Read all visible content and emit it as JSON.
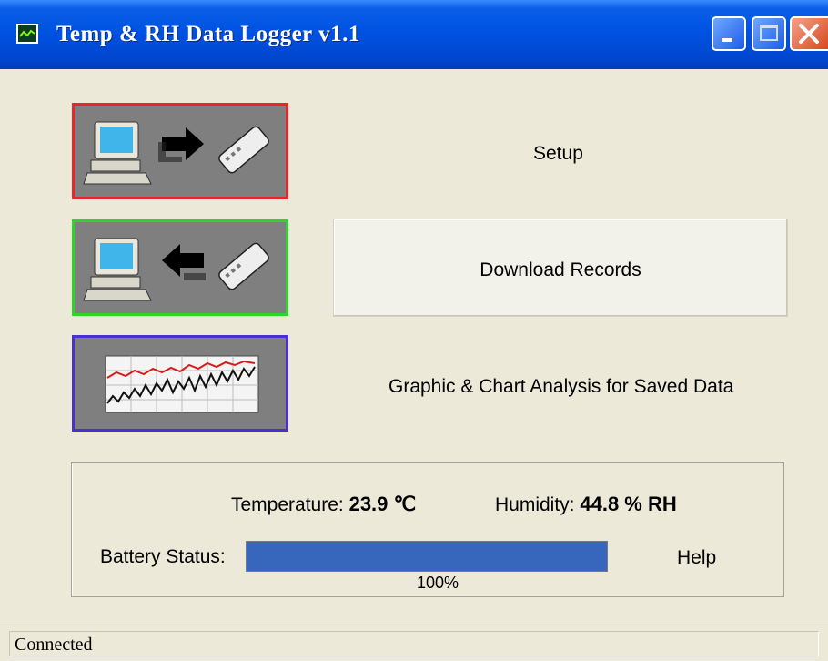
{
  "window": {
    "title": "Temp & RH Data Logger  v1.1"
  },
  "actions": {
    "setup_label": "Setup",
    "download_label": "Download Records",
    "chart_label": "Graphic & Chart Analysis for Saved Data"
  },
  "icons": {
    "setup": [
      "computer-icon",
      "arrow-right-icon",
      "data-logger-icon"
    ],
    "download": [
      "computer-icon",
      "arrow-left-icon",
      "data-logger-icon"
    ],
    "chart": "line-chart-icon"
  },
  "readings": {
    "temperature_label": "Temperature:",
    "temperature_value": "23.9 ℃",
    "humidity_label": "Humidity:",
    "humidity_value": "44.8 % RH"
  },
  "battery": {
    "label": "Battery Status:",
    "percent_text": "100%",
    "level": 1.0
  },
  "help_label": "Help",
  "status_bar": {
    "text": "Connected"
  },
  "colors": {
    "setup_border": "#e8252a",
    "download_border": "#2bd62b",
    "chart_border": "#4a2fd1",
    "progress": "#3767bd"
  }
}
